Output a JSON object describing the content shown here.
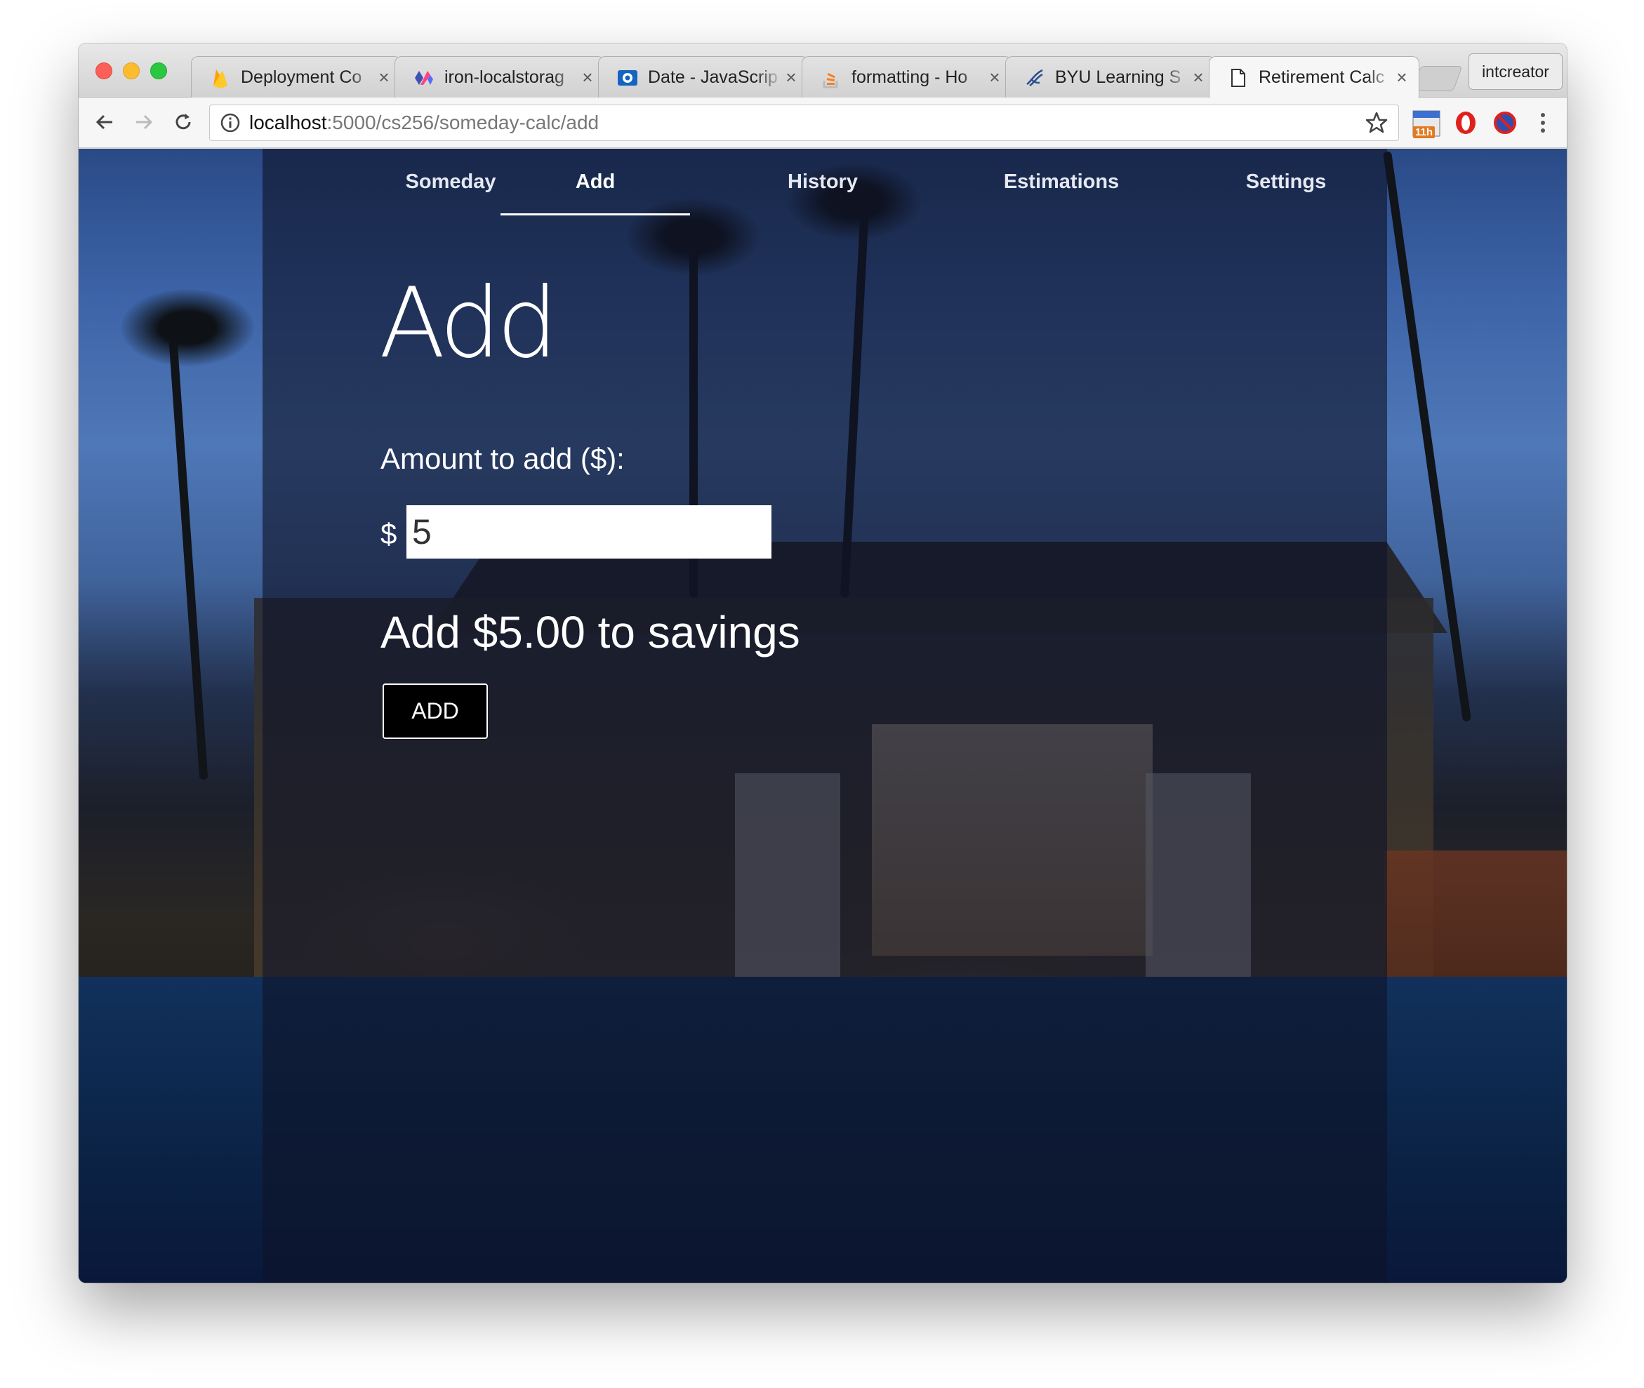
{
  "browser": {
    "tabs": [
      {
        "title": "Deployment Co",
        "favicon": "firebase-icon",
        "active": false
      },
      {
        "title": "iron-localstorag",
        "favicon": "polymer-icon",
        "active": false
      },
      {
        "title": "Date - JavaScrip",
        "favicon": "mdn-icon",
        "active": false
      },
      {
        "title": "formatting - Ho",
        "favicon": "stackoverflow-icon",
        "active": false
      },
      {
        "title": "BYU Learning S",
        "favicon": "byu-icon",
        "active": false
      },
      {
        "title": "Retirement Calc",
        "favicon": "document-icon",
        "active": true
      }
    ],
    "profile_label": "intcreator",
    "url_host": "localhost",
    "url_path": ":5000/cs256/someday-calc/add",
    "extension_badge": "11h"
  },
  "nav": {
    "items": [
      {
        "label": "Someday",
        "selected": false
      },
      {
        "label": "Add",
        "selected": true
      },
      {
        "label": "History",
        "selected": false
      },
      {
        "label": "Estimations",
        "selected": false
      },
      {
        "label": "Settings",
        "selected": false
      }
    ]
  },
  "page": {
    "title": "Add",
    "amount_label": "Amount to add ($):",
    "currency_symbol": "$",
    "amount_value": "5",
    "summary": "Add $5.00 to savings",
    "add_button": "ADD"
  },
  "colors": {
    "overlay": "#0e1428",
    "accent": "#ffffff",
    "button_bg": "#000000"
  }
}
